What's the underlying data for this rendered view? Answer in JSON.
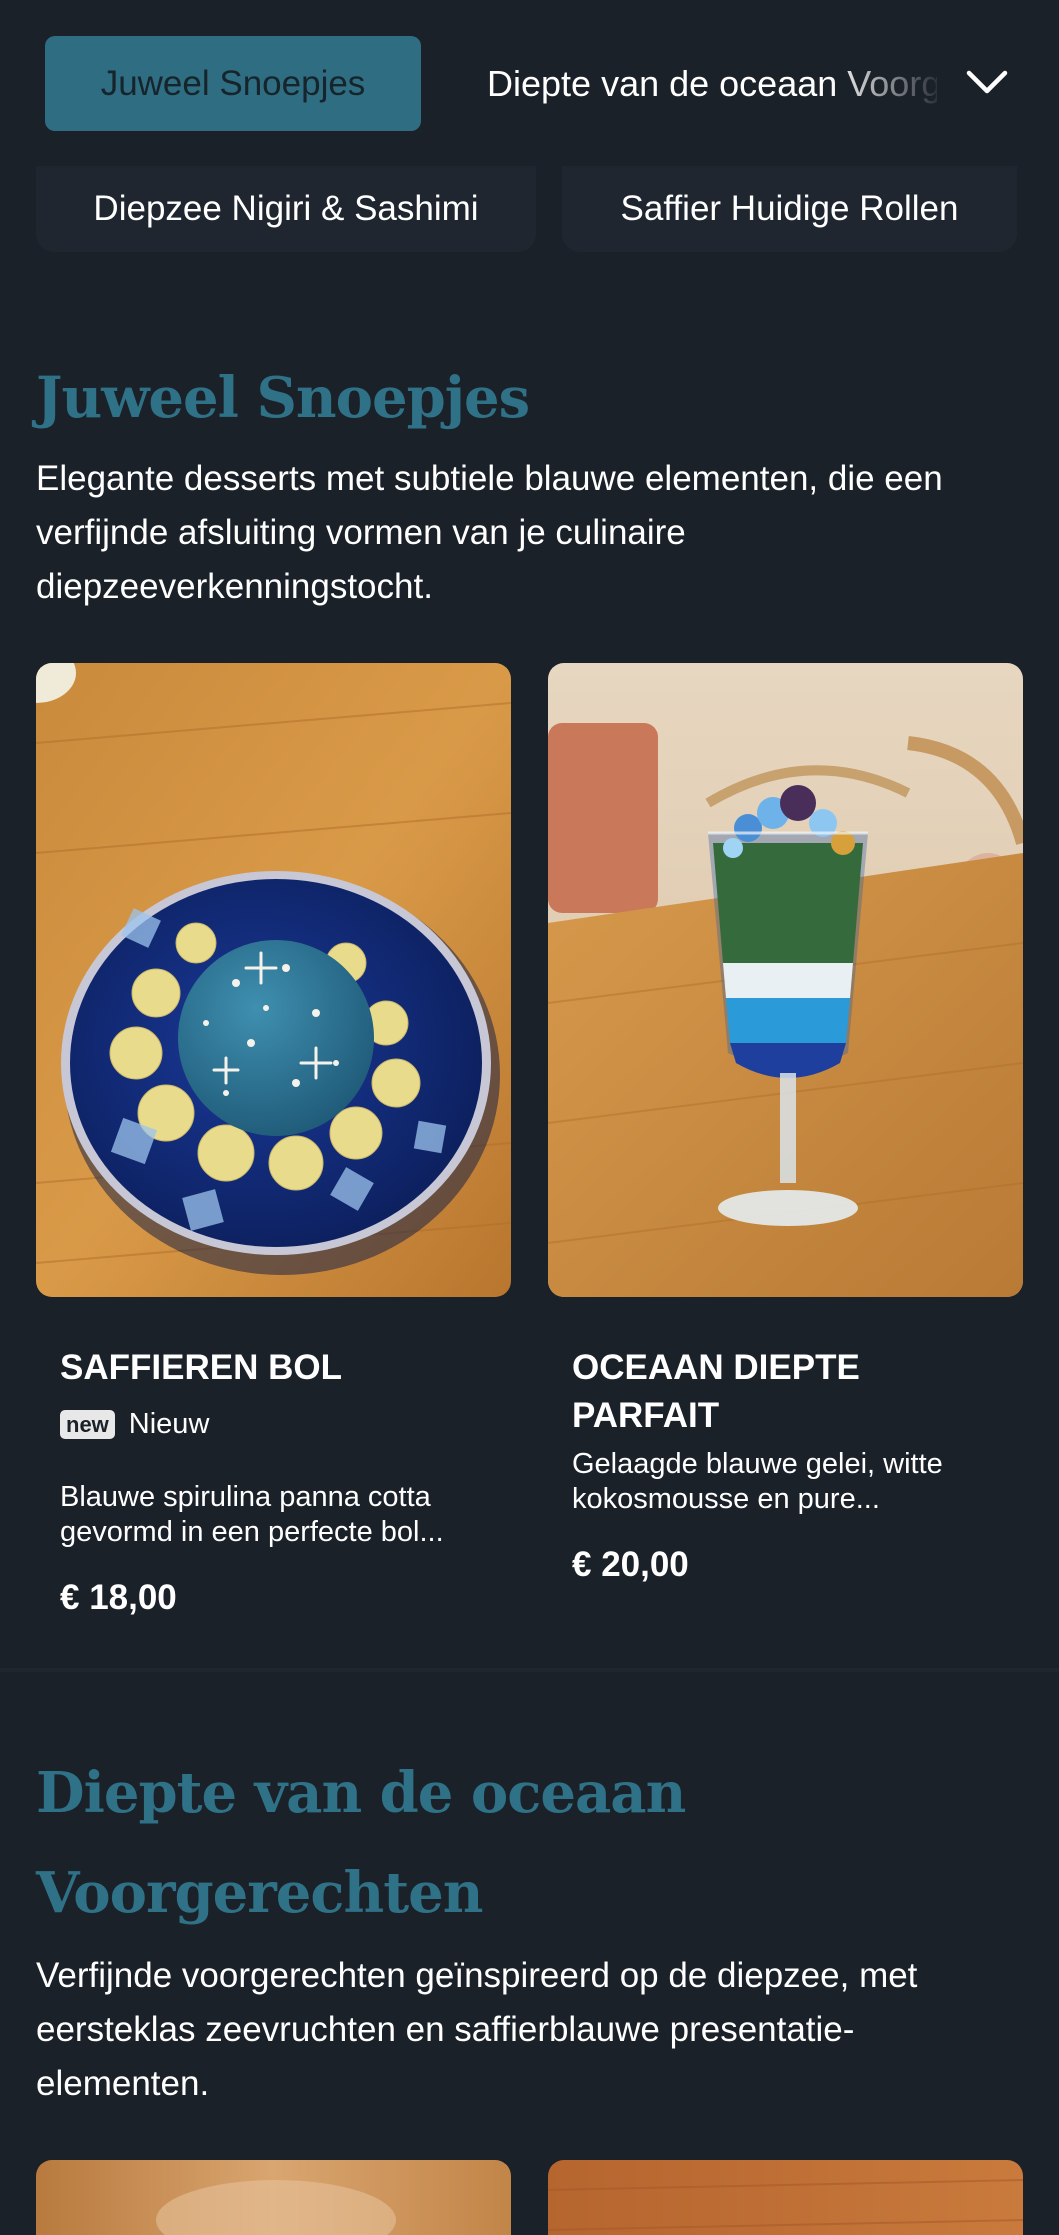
{
  "nav": {
    "active_tab": "Juweel Snoepjes",
    "next_tab": "Diepte van de oceaan Voorgerechten",
    "dropdown_icon": "chevron-down-icon"
  },
  "category_pills": [
    {
      "label": "Diepzee Nigiri & Sashimi"
    },
    {
      "label": "Saffier Huidige Rollen"
    }
  ],
  "sections": [
    {
      "title": "Juweel Snoepjes",
      "description": "Elegante desserts met subtiele blauwe elementen, die een verfijnde afsluiting vormen van je culinaire diepzeeverkenningstocht.",
      "items": [
        {
          "name": "SAFFIEREN BOL",
          "badge": "new",
          "badge_label": "Nieuw",
          "description": "Blauwe spirulina panna cotta gevormd in een perfecte bol...",
          "price": "€ 18,00"
        },
        {
          "name": "OCEAAN DIEPTE PARFAIT",
          "description": "Gelaagde blauwe gelei, witte kokosmousse en pure...",
          "price": "€ 20,00"
        }
      ]
    },
    {
      "title_line1": "Diepte van de oceaan",
      "title_line2": "Voorgerechten",
      "description": "Verfijnde voorgerechten geïnspireerd op de diepzee, met eersteklas zeevruchten en saffierblauwe presentatie-elementen."
    }
  ],
  "colors": {
    "background": "#1b2129",
    "accent": "#2f7187",
    "active_tab": "#2f6e82"
  }
}
